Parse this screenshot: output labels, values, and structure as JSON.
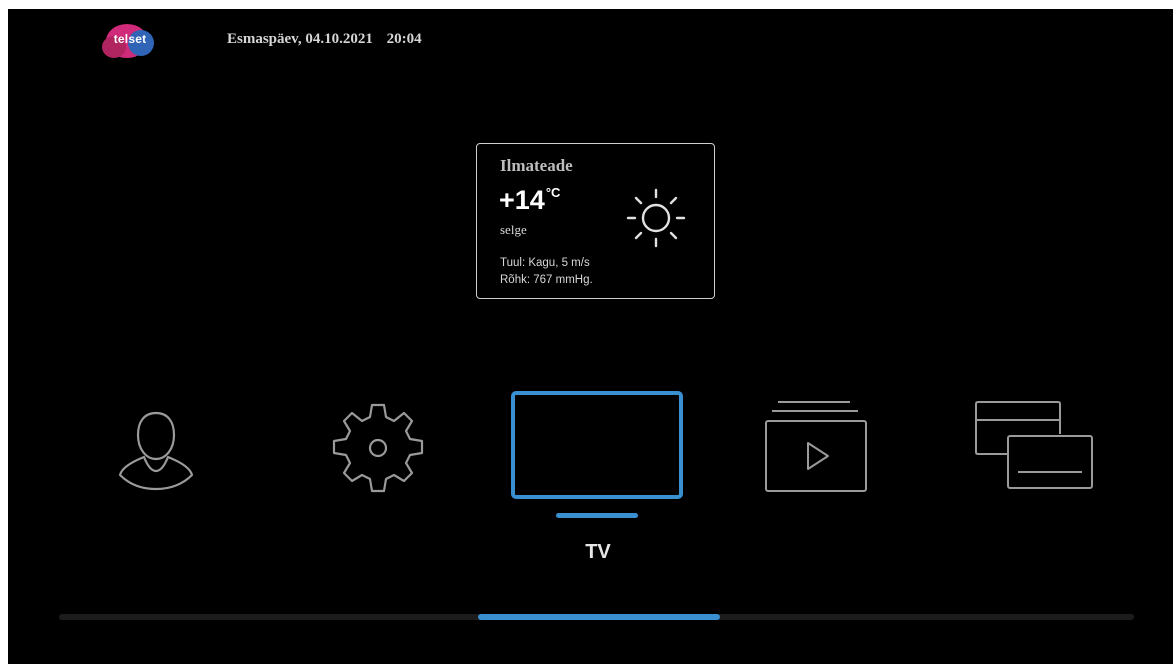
{
  "header": {
    "logo_text": "telset",
    "date": "Esmaspäev, 04.10.2021",
    "time": "20:04"
  },
  "weather": {
    "title": "Ilmateade",
    "temperature": "+14",
    "unit": "°C",
    "condition": "selge",
    "wind": "Tuul: Kagu, 5 m/s",
    "pressure": "Rõhk: 767 mmHg.",
    "icon": "sun-icon"
  },
  "menu": {
    "items": [
      {
        "icon": "profile-icon"
      },
      {
        "icon": "settings-gear-icon"
      },
      {
        "icon": "tv-icon",
        "selected": true
      },
      {
        "icon": "video-library-icon"
      },
      {
        "icon": "apps-cards-icon"
      }
    ],
    "selected_label": "TV"
  },
  "scrollbar": {
    "position_fraction": 0.39,
    "thumb_fraction": 0.225
  },
  "colors": {
    "background": "#000000",
    "accent": "#3a8fd0",
    "icon_stroke": "#9a9a9a",
    "text": "#d6d6d6"
  }
}
